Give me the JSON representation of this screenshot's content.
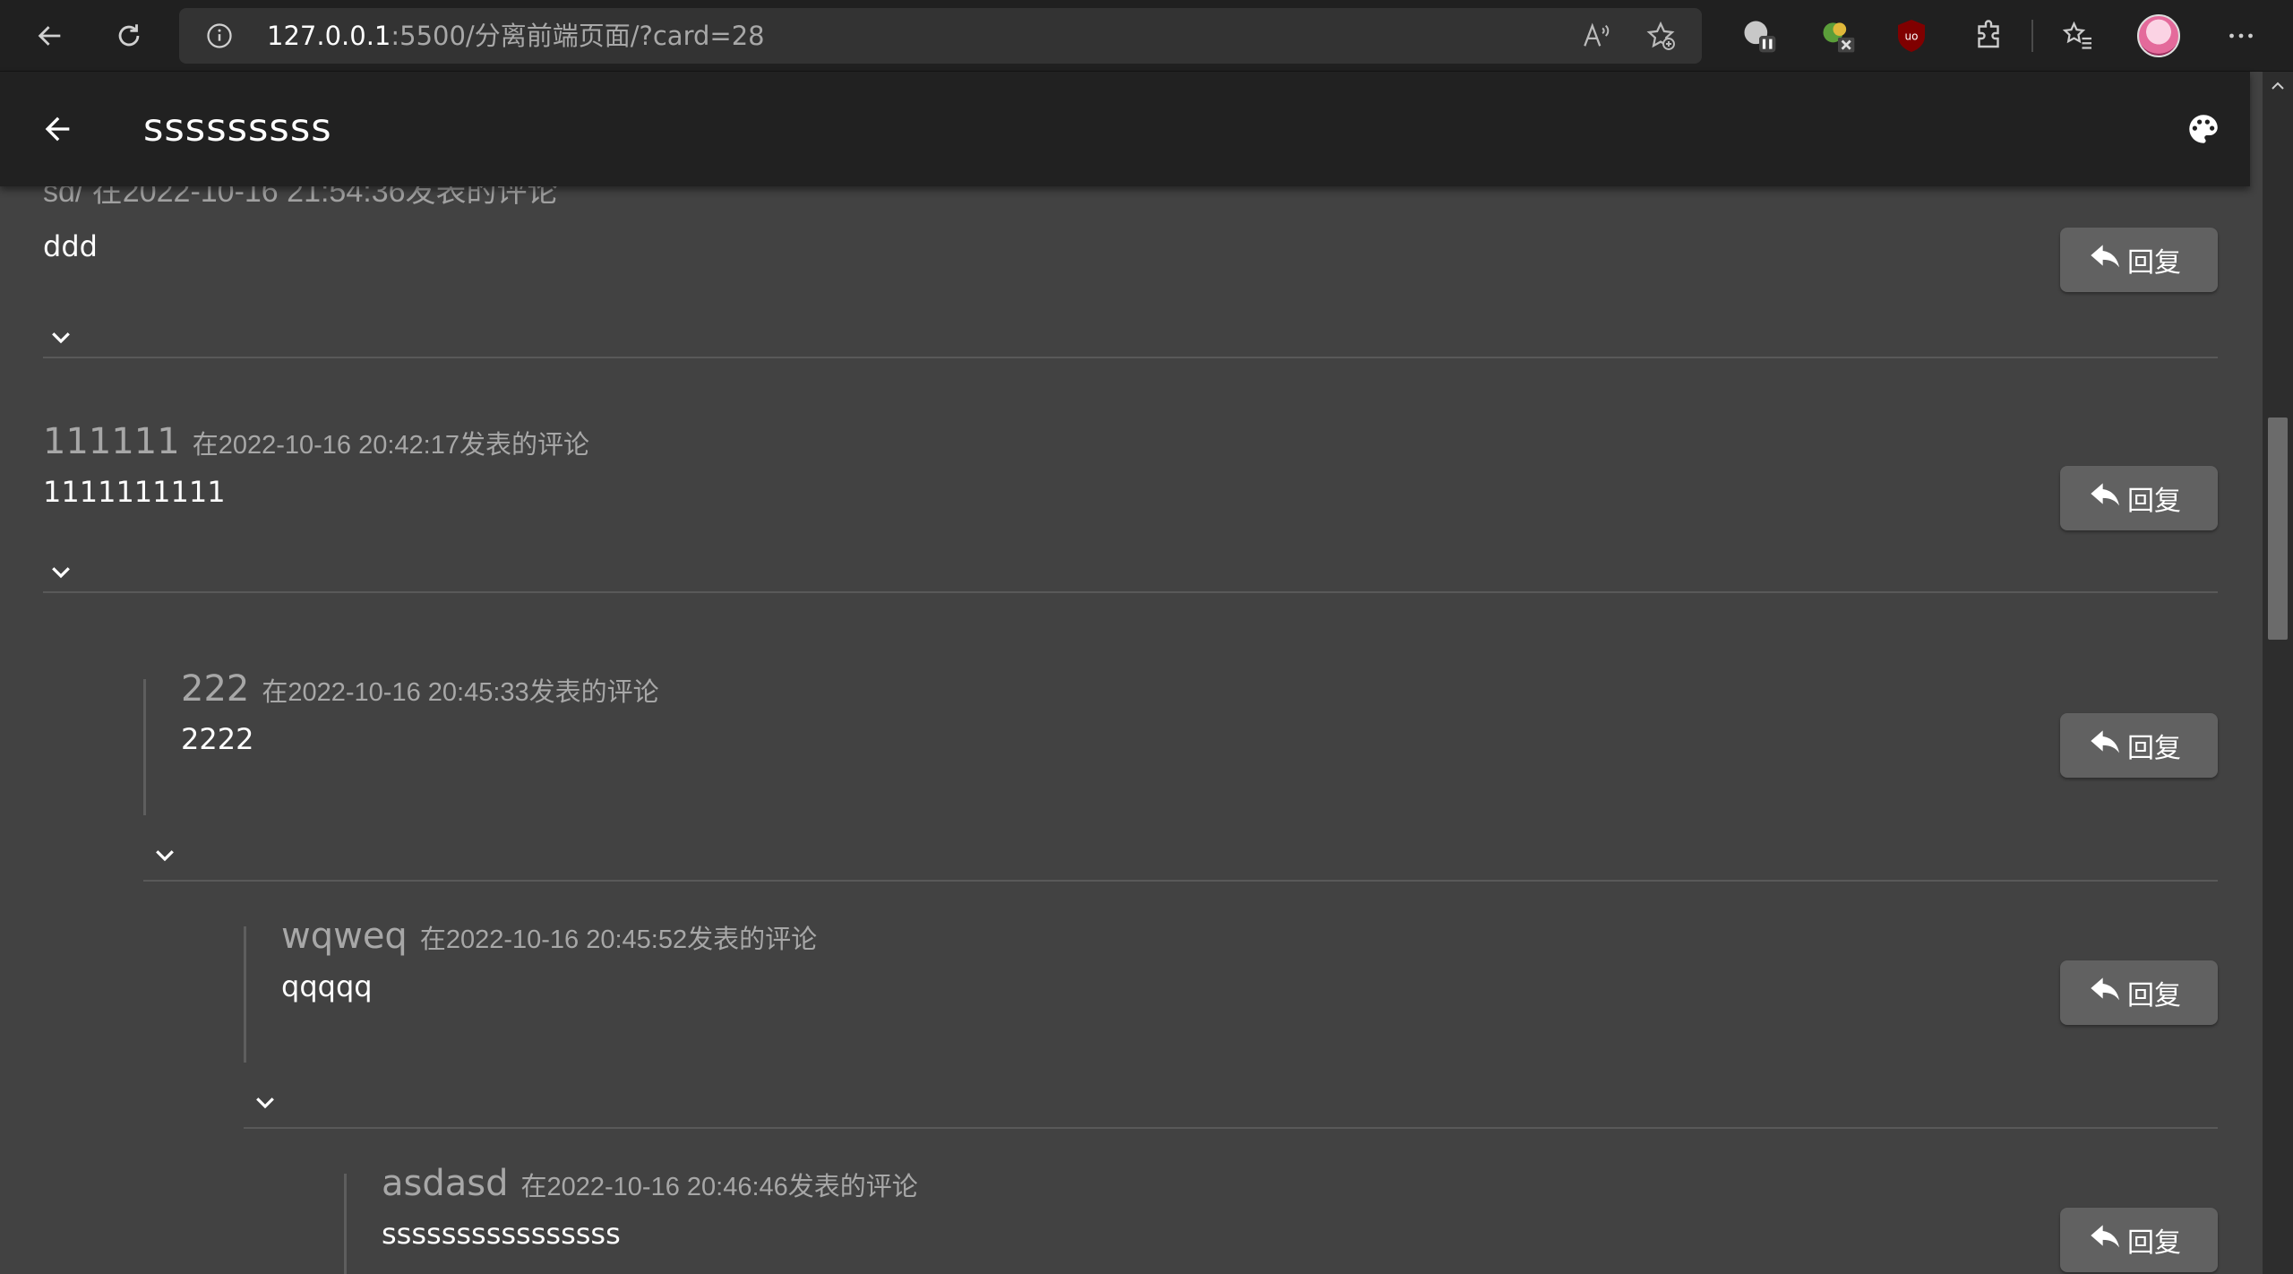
{
  "browser": {
    "url_host": "127.0.0.1",
    "url_rest": ":5500/分离前端页面/?card=28"
  },
  "app": {
    "title": "sssssssss"
  },
  "partial_comment": {
    "header_fragment": "sd/  在2022-10-16 21:54:36发表的评论",
    "body": "ddd"
  },
  "comments": [
    {
      "author": "111111",
      "meta": "在2022-10-16 20:42:17发表的评论",
      "body": "1111111111"
    },
    {
      "author": "222",
      "meta": "在2022-10-16 20:45:33发表的评论",
      "body": "2222"
    },
    {
      "author": "wqweq",
      "meta": "在2022-10-16 20:45:52发表的评论",
      "body": "qqqqq"
    },
    {
      "author": "asdasd",
      "meta": "在2022-10-16 20:46:46发表的评论",
      "body": "ssssssssssssssss"
    }
  ],
  "reply_label": "回复",
  "colors": {
    "page_bg": "#424242",
    "header_bg": "#212121",
    "button_bg": "#616161",
    "muted_text": "#a7a7a7"
  }
}
